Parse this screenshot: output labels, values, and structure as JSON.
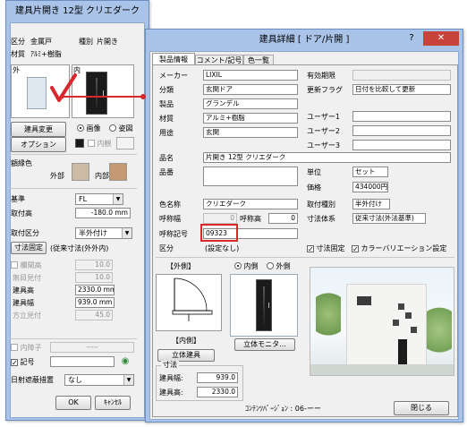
{
  "left_window": {
    "title": "建具片開き 12型 クリエダーク <1/1>",
    "kubun_label": "区分",
    "kubun_value": "金属戸",
    "shubetsu_label": "種別",
    "shubetsu_value": "片開き",
    "zaishitsu_label": "材質",
    "zaishitsu_value": "ｱﾙﾐ+樹脂",
    "soto_label": "外",
    "uchi_label": "内",
    "change_button": "建具変更",
    "image_radio": "画像",
    "shape_radio": "姿図",
    "option_button": "オプション",
    "naisho_label": "内観",
    "color_label": "額縁色",
    "gaibu_label": "外部",
    "naibu_label": "内部",
    "kijun_label": "基準",
    "kijun_value": "FL",
    "toritsukedaka_label": "取付高",
    "toritsukedaka_value": "-180.0 mm",
    "toritsuke_kubun_label": "取付区分",
    "toritsuke_kubun_value": "半外付け",
    "sunpo_kotei_label": "寸法固定",
    "sunpo_value": "(従来寸法(外外内)",
    "ranma_label": "欄間高",
    "ranma_value": "10.0",
    "mujimi_label": "無目見付",
    "mujimi_value": "10.0",
    "tategu_height_label": "建具高",
    "tategu_height_value": "2330.0 mm",
    "tategu_width_label": "建具幅",
    "tategu_width_value": "939.0 mm",
    "houdate_label": "方立見付",
    "houdate_value": "45.0",
    "naishoji_label": "内障子",
    "naishoji_value": "-----",
    "kigou_label": "記号",
    "hiyoke_label": "日射遮蔽措置",
    "hiyoke_value": "なし",
    "ok_button": "OK",
    "cancel_button": "ｷｬﾝｾﾙ"
  },
  "right_window": {
    "title": "建具詳細 [ ドア/片開 ]",
    "help_glyph": "?",
    "close_glyph": "✕",
    "tabs": [
      "製品情報",
      "コメント/記号",
      "色一覧"
    ],
    "maker_label": "メーカー",
    "maker_value": "LIXIL",
    "bunrui_label": "分類",
    "bunrui_value": "玄関ドア",
    "seihin_label": "製品",
    "seihin_value": "グランデル",
    "zaishitsu_label": "材質",
    "zaishitsu_value": "アルミ+樹脂",
    "youto_label": "用途",
    "youto_value": "玄関",
    "yuko_label": "有効期限",
    "yuko_value": "",
    "koshin_label": "更新フラグ",
    "koshin_value": "日付を比較して更新",
    "user1_label": "ユーザー1",
    "user2_label": "ユーザー2",
    "user3_label": "ユーザー3",
    "hinmei_label": "品名",
    "hinmei_value": "片開き 12型 クリエダーク",
    "hinban_label": "品番",
    "tani_label": "単位",
    "tani_value": "セット",
    "kakaku_label": "価格",
    "kakaku_value": "434000円",
    "iromei_label": "色名称",
    "iromei_value": "クリエダーク",
    "kouhaba_label": "呼称幅",
    "kouhaba_value": "0",
    "koukou_label": "呼称高",
    "koukou_value": "0",
    "kigo_label": "呼称記号",
    "kigo_value": "09323",
    "kubun_label": "区分",
    "kubun_value": "(設定なし)",
    "toritsuke_label": "取付種別",
    "toritsuke_value": "半外付け",
    "sunpo_label": "寸法体系",
    "sunpo_value": "従来寸法(外法基準)",
    "sunpo_kotei_label": "寸法固定",
    "color_variation_label": "カラーバリエーション設定",
    "gaigawa_header": "【外側】",
    "naigawa_radio": "内側",
    "sotogawa_radio": "外側",
    "naigawa_caption": "【内側】",
    "rittai_tategu_label": "立体建具",
    "rittai_monitor_button": "立体モニタ...",
    "sunpo_group_label": "寸法",
    "width_label": "建具幅:",
    "width_value": "939.0",
    "height_label": "建具高:",
    "height_value": "2330.0",
    "content_version": "ｺﾝﾃﾝﾂﾊﾞｰｼﾞｮﾝ : 06-ーー",
    "close_button": "閉じる"
  },
  "colors": {
    "window_frame": "#a9c4e8",
    "panel": "#f0f0f0",
    "close_red": "#c7433a",
    "highlight_red": "#d9272e",
    "swatch_gaibu": "#cbbba4",
    "swatch_naibu": "#c49a72"
  }
}
